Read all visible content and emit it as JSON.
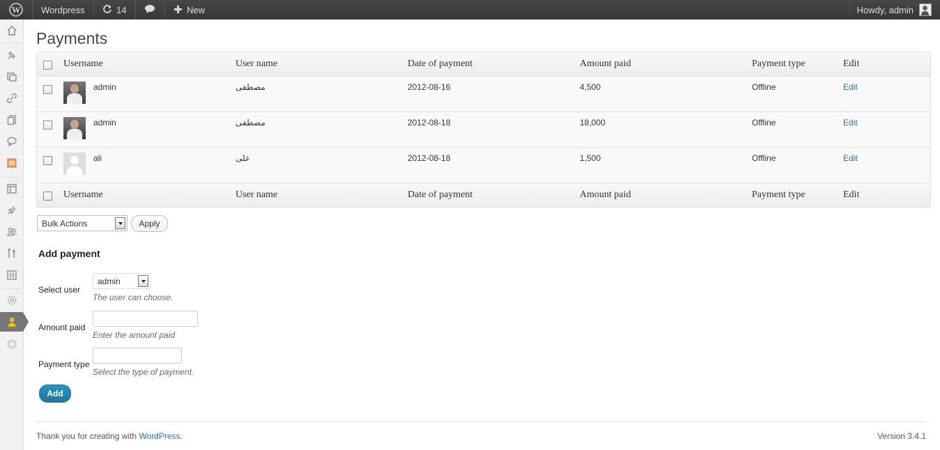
{
  "adminbar": {
    "site_name": "Wordpress",
    "updates_count": "14",
    "new_label": "New",
    "howdy": "Howdy, admin"
  },
  "page": {
    "title": "Payments"
  },
  "table": {
    "columns": [
      "Username",
      "User name",
      "Date of payment",
      "Amount paid",
      "Payment type",
      "Edit"
    ],
    "rows": [
      {
        "username": "admin",
        "display_name": "مصطفى",
        "date": "2012-08-16",
        "amount": "4,500",
        "type": "Offline",
        "edit": "Edit",
        "avatar": "photo"
      },
      {
        "username": "admin",
        "display_name": "مصطفى",
        "date": "2012-08-18",
        "amount": "18,000",
        "type": "Offline",
        "edit": "Edit",
        "avatar": "photo"
      },
      {
        "username": "ali",
        "display_name": "علی",
        "date": "2012-08-18",
        "amount": "1,500",
        "type": "Offline",
        "edit": "Edit",
        "avatar": "mystery"
      }
    ]
  },
  "bulk": {
    "selected": "Bulk Actions",
    "apply_label": "Apply"
  },
  "form": {
    "title": "Add payment",
    "user_label": "Select user",
    "user_value": "admin",
    "user_desc": "The user can choose.",
    "amount_label": "Amount paid",
    "amount_value": "",
    "amount_desc": "Enter the amount paid",
    "type_label": "Payment type",
    "type_value": "",
    "type_desc": "Select the type of payment.",
    "add_label": "Add"
  },
  "footer": {
    "thanks": "Thank you for creating with ",
    "wordpress_link": "WordPress",
    "period": ".",
    "version": "Version 3.4.1"
  },
  "colors": {
    "adminbar_bg": "#464646",
    "link": "#21759b",
    "primary_button": "#21759b",
    "menu_current": "#777777",
    "menu_current_icon": "#f2c200"
  },
  "menu_icons": [
    "dashboard-icon",
    "posts-icon",
    "media-icon",
    "links-icon",
    "pages-icon",
    "comments-icon",
    "custom-icon",
    "appearance-icon",
    "plugins-icon",
    "users-icon",
    "tools-icon",
    "settings-icon",
    "plugin-settings-icon",
    "payments-user-icon",
    "collapse-icon"
  ]
}
